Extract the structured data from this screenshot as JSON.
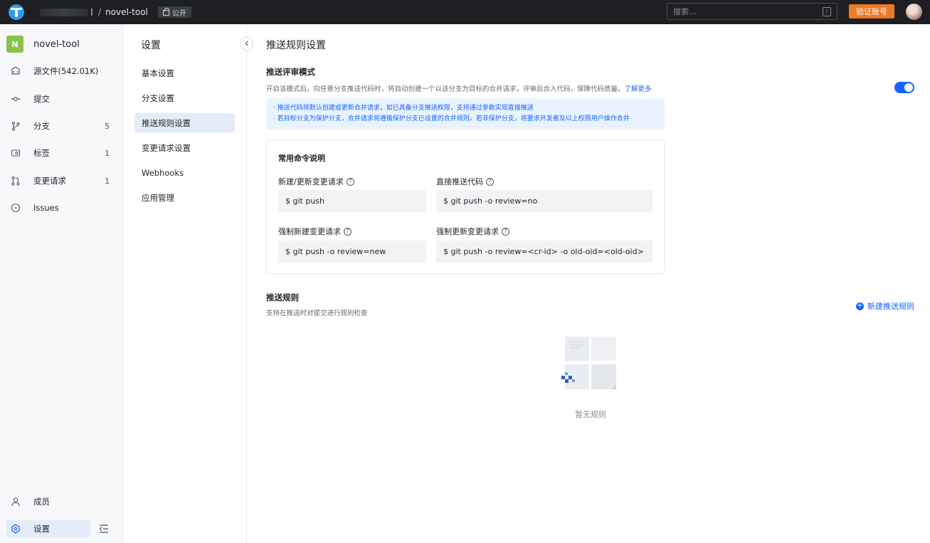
{
  "topbar": {
    "repo_name": "novel-tool",
    "separator": "/",
    "visibility": "公开",
    "search_placeholder": "搜索...",
    "search_shortcut": "/",
    "verify_button": "验证账号"
  },
  "sidebar": {
    "repo_initial": "N",
    "repo_name": "novel-tool",
    "items": [
      {
        "label": "源文件(542.01K)",
        "count": "",
        "icon": "code-folder-icon"
      },
      {
        "label": "提交",
        "count": "",
        "icon": "commit-icon"
      },
      {
        "label": "分支",
        "count": "5",
        "icon": "branch-icon"
      },
      {
        "label": "标签",
        "count": "1",
        "icon": "tag-icon"
      },
      {
        "label": "变更请求",
        "count": "1",
        "icon": "merge-request-icon"
      },
      {
        "label": "Issues",
        "count": "",
        "icon": "issue-icon"
      }
    ],
    "bottom_items": [
      {
        "label": "成员",
        "icon": "user-icon"
      },
      {
        "label": "设置",
        "icon": "settings-icon"
      }
    ]
  },
  "subnav": {
    "title": "设置",
    "items": [
      {
        "label": "基本设置"
      },
      {
        "label": "分支设置"
      },
      {
        "label": "推送规则设置"
      },
      {
        "label": "变更请求设置"
      },
      {
        "label": "Webhooks"
      },
      {
        "label": "应用管理"
      }
    ]
  },
  "main": {
    "title": "推送规则设置",
    "review_mode": {
      "title": "推送评审模式",
      "desc": "开启该模式后，向任意分支推送代码时，将自动创建一个以该分支为目标的合并请求，评审后合入代码，保障代码质量。",
      "learn_more": "了解更多",
      "enabled": true,
      "info_lines": [
        "· 推送代码将默认创建或更新合并请求，如已具备分支推送权限，支持通过参数实现直接推送",
        "· 若目标分支为保护分支，合并请求将遵循保护分支已设置的合并规则。若非保护分支，将要求开发者及以上权限用户操作合并"
      ]
    },
    "commands": {
      "title": "常用命令说明",
      "items": [
        {
          "label": "新建/更新变更请求",
          "cmd": "$ git push"
        },
        {
          "label": "直接推送代码",
          "cmd": "$ git push -o review=no"
        },
        {
          "label": "强制新建变更请求",
          "cmd": "$ git push -o review=new"
        },
        {
          "label": "强制更新变更请求",
          "cmd": "$ git push -o review=<cr-id> -o old-oid=<old-oid>"
        }
      ]
    },
    "push_rules": {
      "title": "推送规则",
      "desc": "支持在推送时对提交进行规则检查",
      "new_button": "新建推送规则",
      "empty_text": "暂无规则"
    }
  },
  "colors": {
    "accent": "#1664ff",
    "warning": "#ef7a24",
    "topbar": "#1d1f22"
  }
}
